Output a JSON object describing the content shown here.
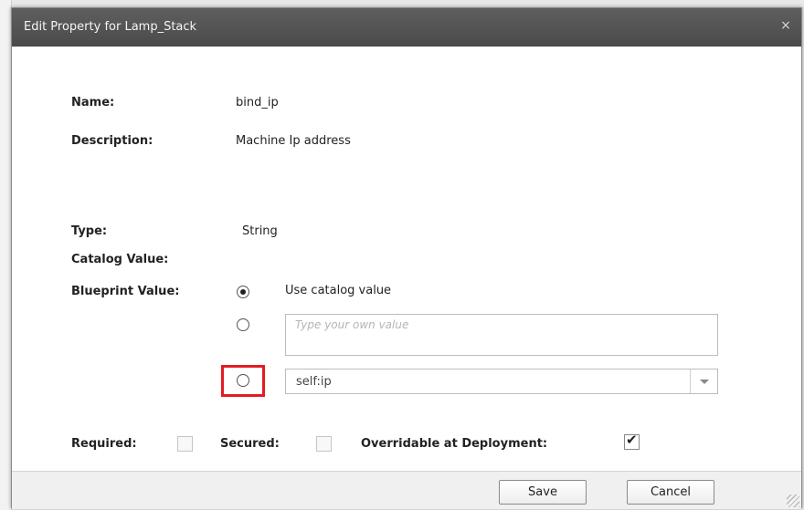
{
  "dialog": {
    "title": "Edit Property for Lamp_Stack",
    "close_symbol": "×"
  },
  "fields": {
    "name_label": "Name:",
    "name_value": "bind_ip",
    "description_label": "Description:",
    "description_value": "Machine Ip address",
    "type_label": "Type:",
    "type_value": "String",
    "catalog_label": "Catalog Value:",
    "blueprint_label": "Blueprint Value:"
  },
  "blueprint": {
    "use_catalog_label": "Use catalog value",
    "own_value_placeholder": "Type your own value",
    "select_value": "self:ip",
    "selected_option": "use-catalog"
  },
  "flags": {
    "required_label": "Required:",
    "required_checked": false,
    "secured_label": "Secured:",
    "secured_checked": false,
    "overridable_label": "Overridable at Deployment:",
    "overridable_checked": true
  },
  "footer": {
    "save_label": "Save",
    "cancel_label": "Cancel"
  },
  "colors": {
    "titlebar": "#555555",
    "highlight": "#e21c23"
  }
}
